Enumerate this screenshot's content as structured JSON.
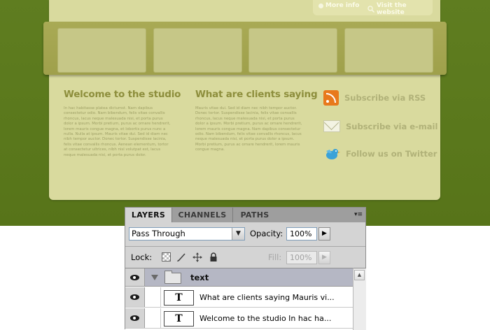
{
  "website": {
    "top_links": [
      "More info",
      "Visit the website"
    ],
    "sections": [
      {
        "title": "Welcome to the studio",
        "body": "In hac habitasse platea dictumst. Nam dapibus consectetur odio. Nam bibendum, felis vitae convallis rhoncus, lacus neque malesuada nisi, et porta purus dolor a ipsum. Morbi pretium, purus ac ornare hendrerit, lorem mauris congue magna, et lobortis purus nunc a nulla. Nulla at ipsum. Mauris vitae dui. Sed id diam nec nibh tempor auctor. Donec tortor. Suspendisse lacinia, felis vitae convallis rhoncus. Aenean elementum, tortor at consectetur ultrices, nibh nisl volutpat est, lacus neque malesuada nisi, et porta purus dolor."
      },
      {
        "title": "What are clients saying",
        "body": "Mauris vitae dui. Sed id diam nec nibh tempor auctor. Donec tortor. Suspendisse lacinia, felis vitae convallis rhoncus, lacus neque malesuada nisi, et porta purus dolor a ipsum. Morbi pretium, purus ac ornare hendrerit, lorem mauris congue magna. Nam dapibus consectetur odio. Nam bibendum, felis vitae convallis rhoncus, lacus neque malesuada nisi, et porta purus dolor a ipsum. Morbi pretium, purus ac ornare hendrerit, lorem mauris congue magna."
      }
    ],
    "social": [
      {
        "label": "Subscribe via RSS",
        "icon": "rss-icon"
      },
      {
        "label": "Subscribe via e-mail",
        "icon": "mail-icon"
      },
      {
        "label": "Follow us on Twitter",
        "icon": "twitter-bird-icon"
      }
    ]
  },
  "layers_panel": {
    "tabs": [
      "LAYERS",
      "CHANNELS",
      "PATHS"
    ],
    "menu_glyph": "▾≡",
    "blend_mode": "Pass Through",
    "opacity_label": "Opacity:",
    "opacity_value": "100%",
    "lock_label": "Lock:",
    "fill_label": "Fill:",
    "fill_value": "100%",
    "layers": [
      {
        "name": "text",
        "type": "group"
      },
      {
        "name": "What are clients saying  Mauris vi...",
        "type": "text",
        "thumb": "T"
      },
      {
        "name": "Welcome to the studio  In hac ha...",
        "type": "text",
        "thumb": "T"
      }
    ]
  },
  "colors": {
    "page_green": "#5f7d20",
    "card": "#d9da9e",
    "heading": "#8d8e3c",
    "rss_orange": "#e8791c"
  }
}
